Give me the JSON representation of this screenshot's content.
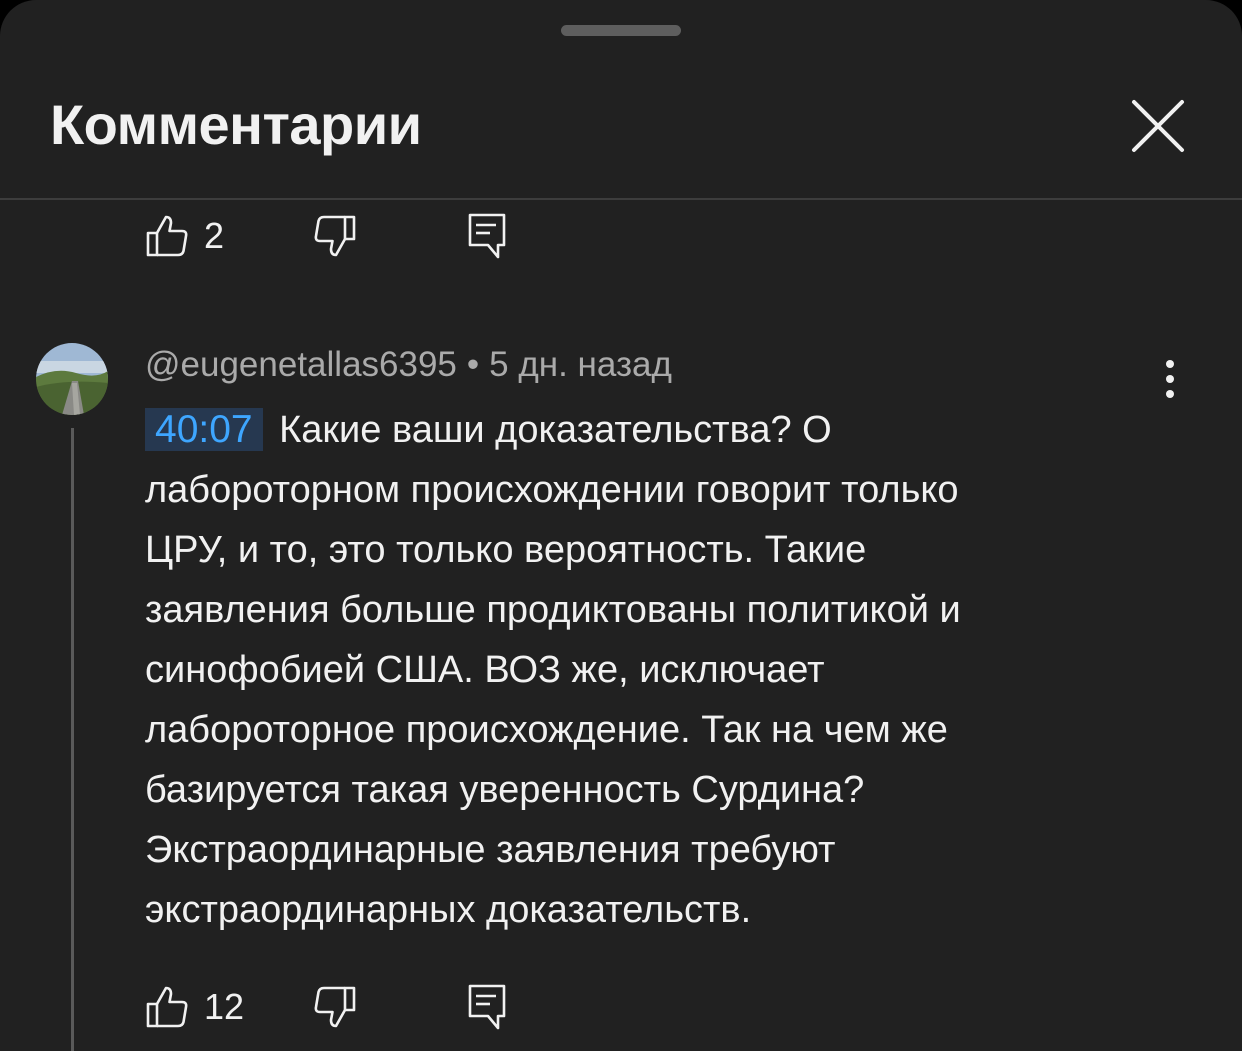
{
  "sheet": {
    "title": "Комментарии"
  },
  "previous_comment": {
    "like_count": "2"
  },
  "comment": {
    "author": "@eugenetallas6395",
    "separator": "•",
    "time": "5 дн. назад",
    "timestamp": "40:07",
    "text_lines": [
      " Какие ваши доказательства? О",
      "лабороторном происхождении говорит только",
      "ЦРУ, и то, это только вероятность. Такие",
      "заявления больше продиктованы политикой и",
      "синофобией США. ВОЗ же, исключает",
      "лабороторное происхождение. Так на чем же",
      "базируется такая уверенность Сурдина?",
      "Экстраординарные заявления требуют",
      "экстраординарных доказательств."
    ],
    "like_count": "12"
  },
  "colors": {
    "background": "#212121",
    "text": "#f1f1f1",
    "secondary_text": "#aaaaaa",
    "link": "#3ea6ff",
    "link_background": "#263850",
    "divider": "#3d3d3d"
  }
}
